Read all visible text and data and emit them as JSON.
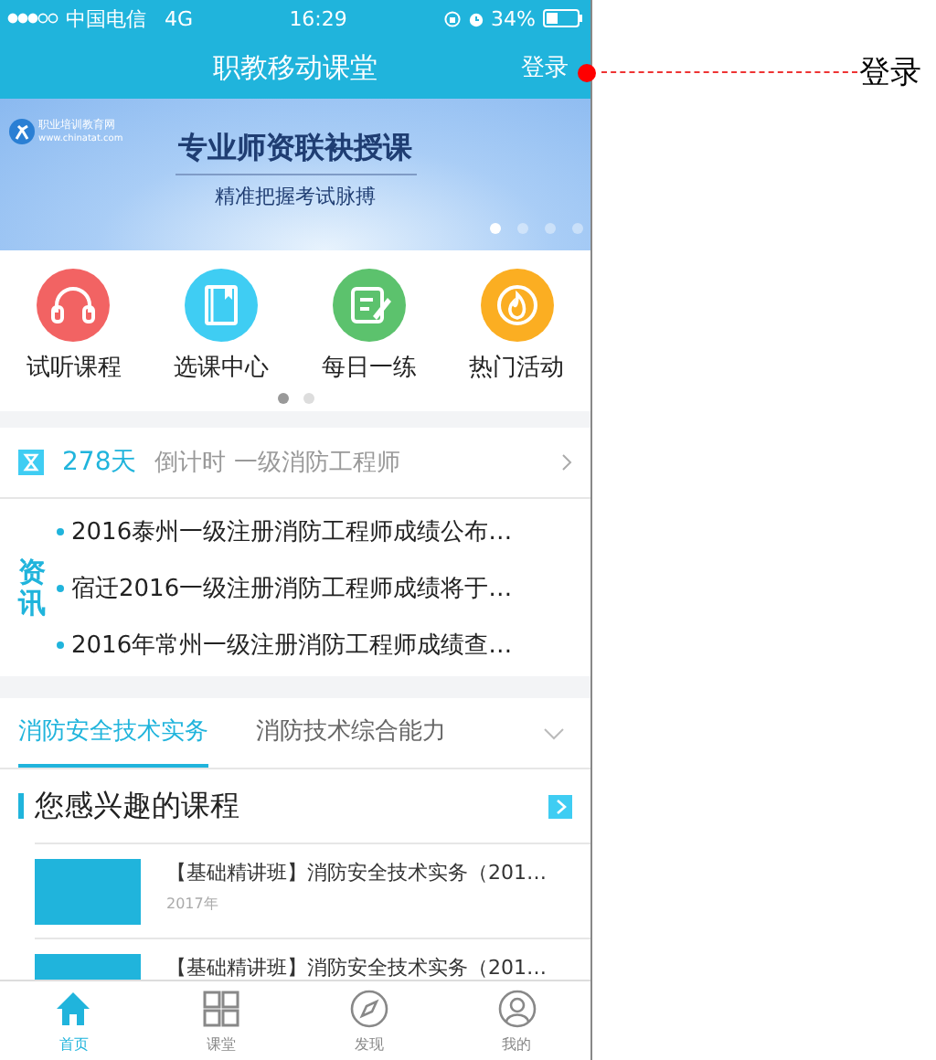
{
  "status_bar": {
    "carrier": "中国电信",
    "network": "4G",
    "time": "16:29",
    "battery": "34%"
  },
  "nav": {
    "title": "职教移动课堂",
    "action": "登录"
  },
  "banner": {
    "logo_title": "职业培训教育网",
    "logo_url": "www.chinatat.com",
    "headline": "专业师资联袂授课",
    "subline": "精准把握考试脉搏",
    "pages": [
      {
        "selected": true
      },
      {
        "selected": false
      },
      {
        "selected": false
      },
      {
        "selected": false
      }
    ]
  },
  "shortcuts": {
    "items": [
      {
        "label": "试听课程",
        "color": "#f26363",
        "kind": "headphones"
      },
      {
        "label": "选课中心",
        "color": "#3fcdf3",
        "kind": "book"
      },
      {
        "label": "每日一练",
        "color": "#5cc26d",
        "kind": "note"
      },
      {
        "label": "热门活动",
        "color": "#fbae22",
        "kind": "flame"
      }
    ],
    "pages": [
      {
        "selected": true
      },
      {
        "selected": false
      }
    ]
  },
  "countdown": {
    "days": "278天",
    "text": "倒计时 一级消防工程师"
  },
  "news": {
    "badge": "资讯",
    "items": [
      "2016泰州一级注册消防工程师成绩公布…",
      "宿迁2016一级注册消防工程师成绩将于…",
      "2016年常州一级注册消防工程师成绩查…"
    ]
  },
  "subject_tabs": [
    {
      "label": "消防安全技术实务",
      "selected": true
    },
    {
      "label": "消防技术综合能力",
      "selected": false
    }
  ],
  "courses": {
    "title": "您感兴趣的课程",
    "items": [
      {
        "title": "【基础精讲班】消防安全技术实务（201…",
        "year": "2017年"
      },
      {
        "title": "【基础精讲班】消防安全技术实务（201…"
      }
    ]
  },
  "tab_bar": [
    {
      "label": "首页",
      "selected": true,
      "kind": "home"
    },
    {
      "label": "课堂",
      "selected": false,
      "kind": "grid"
    },
    {
      "label": "发现",
      "selected": false,
      "kind": "compass"
    },
    {
      "label": "我的",
      "selected": false,
      "kind": "person"
    }
  ],
  "annotation": {
    "label": "登录"
  }
}
